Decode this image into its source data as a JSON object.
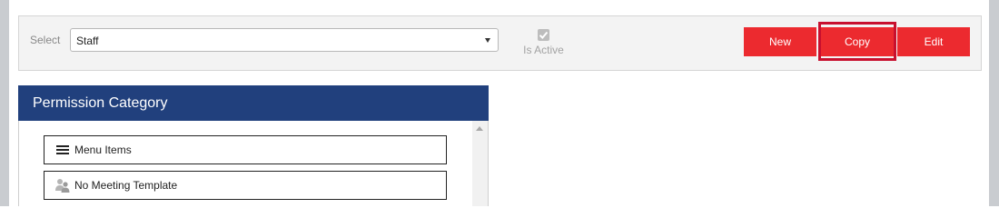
{
  "toolbar": {
    "select_label": "Select",
    "select_value": "Staff",
    "is_active_label": "Is Active",
    "is_active_checked": true,
    "buttons": {
      "new": "New",
      "copy": "Copy",
      "edit": "Edit"
    }
  },
  "permission_panel": {
    "title": "Permission Category",
    "items": [
      {
        "label": "Menu Items",
        "icon": "hamburger-menu-icon"
      },
      {
        "label": "No Meeting Template",
        "icon": "people-icon"
      }
    ]
  },
  "colors": {
    "accent_red": "#ec2a2f",
    "header_blue": "#21407d",
    "highlight": "#c8102e"
  }
}
